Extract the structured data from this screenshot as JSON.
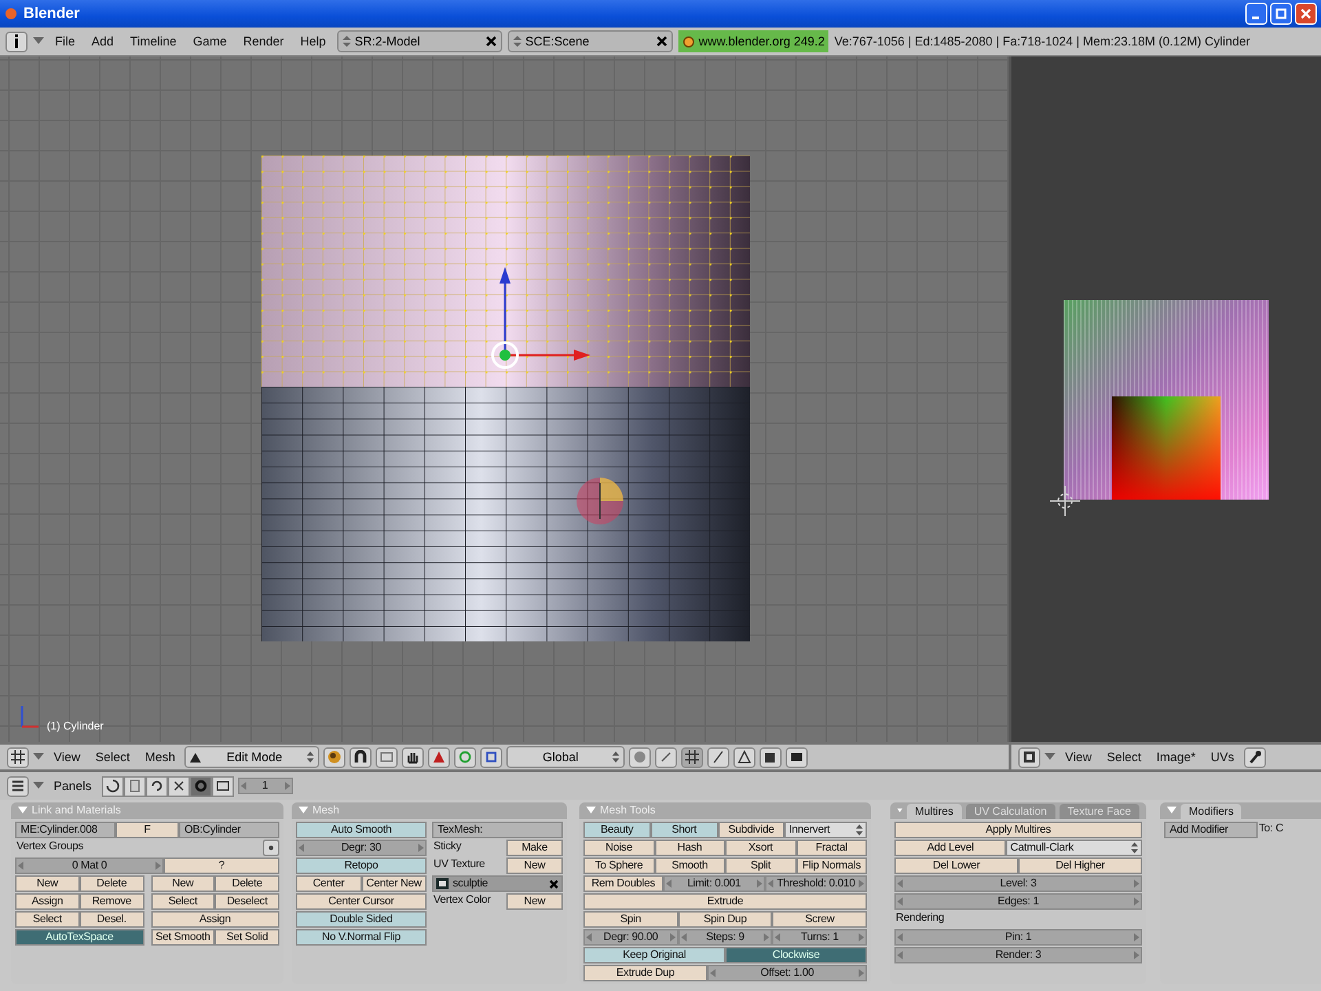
{
  "window": {
    "title": "Blender"
  },
  "menubar": {
    "menus": [
      "File",
      "Add",
      "Timeline",
      "Game",
      "Render",
      "Help"
    ],
    "screen": "SR:2-Model",
    "scene": "SCE:Scene",
    "version": "www.blender.org 249.2",
    "stats": "Ve:767-1056 | Ed:1485-2080 | Fa:718-1024 | Mem:23.18M (0.12M) Cylinder"
  },
  "viewport": {
    "object_label": "(1) Cylinder"
  },
  "viewport_header": {
    "menus": [
      "View",
      "Select",
      "Mesh"
    ],
    "mode": "Edit Mode",
    "orientation": "Global"
  },
  "uv_header": {
    "menus": [
      "View",
      "Select",
      "Image*",
      "UVs"
    ]
  },
  "buttons_header": {
    "label": "Panels",
    "number": "1"
  },
  "panels": [
    {
      "title": "Link and Materials",
      "columns": [
        {
          "rows": [
            [
              [
                {
                  "kind": "field",
                  "text": "ME:Cylinder.008"
                },
                {
                  "kind": "button",
                  "text": "F"
                },
                {
                  "kind": "field",
                  "text": "OB:Cylinder"
                }
              ]
            ],
            [
              [
                {
                  "kind": "label",
                  "text": "Vertex Groups"
                },
                {
                  "kind": "iconbutton"
                }
              ]
            ],
            [
              [
                {
                  "kind": "num",
                  "text": "0 Mat 0"
                },
                {
                  "kind": "button",
                  "text": "?"
                }
              ]
            ],
            [
              [
                {
                  "kind": "button",
                  "text": "New"
                },
                {
                  "kind": "button",
                  "text": "Delete"
                }
              ],
              [
                {
                  "kind": "button",
                  "text": "New"
                },
                {
                  "kind": "button",
                  "text": "Delete"
                }
              ]
            ],
            [
              [
                {
                  "kind": "button",
                  "text": "Assign"
                },
                {
                  "kind": "button",
                  "text": "Remove"
                }
              ],
              [
                {
                  "kind": "button",
                  "text": "Select"
                },
                {
                  "kind": "button",
                  "text": "Deselect"
                }
              ]
            ],
            [
              [
                {
                  "kind": "button",
                  "text": "Select"
                },
                {
                  "kind": "button",
                  "text": "Desel."
                }
              ],
              [
                {
                  "kind": "button",
                  "text": "Assign"
                }
              ]
            ],
            [
              [
                {
                  "kind": "toggle",
                  "text": "AutoTexSpace",
                  "on": true
                }
              ],
              [
                {
                  "kind": "button",
                  "text": "Set Smooth"
                },
                {
                  "kind": "button",
                  "text": "Set Solid"
                }
              ]
            ]
          ]
        }
      ]
    },
    {
      "title": "Mesh",
      "columns": [
        {
          "rows": [
            [
              [
                {
                  "kind": "toggle",
                  "text": "Auto Smooth",
                  "on": false
                }
              ]
            ],
            [
              [
                {
                  "kind": "num",
                  "text": "Degr: 30"
                }
              ]
            ],
            [
              [
                {
                  "kind": "toggle",
                  "text": "Retopo",
                  "on": false
                }
              ]
            ],
            [
              [
                {
                  "kind": "button",
                  "text": "Center"
                },
                {
                  "kind": "button",
                  "text": "Center New"
                }
              ]
            ],
            [
              [
                {
                  "kind": "button",
                  "text": "Center Cursor"
                }
              ]
            ],
            [
              [
                {
                  "kind": "toggle",
                  "text": "Double Sided",
                  "on": false
                }
              ]
            ],
            [
              [
                {
                  "kind": "toggle",
                  "text": "No V.Normal Flip",
                  "on": false
                }
              ]
            ]
          ]
        },
        {
          "rows": [
            [
              [
                {
                  "kind": "field",
                  "text": "TexMesh:"
                }
              ]
            ],
            [
              [
                {
                  "kind": "label",
                  "text": "Sticky"
                },
                {
                  "kind": "button",
                  "text": "Make"
                }
              ]
            ],
            [
              [
                {
                  "kind": "label",
                  "text": "UV Texture"
                },
                {
                  "kind": "button",
                  "text": "New"
                }
              ]
            ],
            [
              [
                {
                  "kind": "layer",
                  "text": "sculptie"
                }
              ]
            ],
            [
              [
                {
                  "kind": "label",
                  "text": "Vertex Color"
                },
                {
                  "kind": "button",
                  "text": "New"
                }
              ]
            ]
          ]
        }
      ]
    },
    {
      "title": "Mesh Tools",
      "columns": [
        {
          "rows": [
            [
              [
                {
                  "kind": "toggle",
                  "text": "Beauty",
                  "on": false
                },
                {
                  "kind": "toggle",
                  "text": "Short",
                  "on": false
                },
                {
                  "kind": "button",
                  "text": "Subdivide"
                },
                {
                  "kind": "menu",
                  "text": "Innervert"
                }
              ]
            ],
            [
              [
                {
                  "kind": "button",
                  "text": "Noise"
                },
                {
                  "kind": "button",
                  "text": "Hash"
                },
                {
                  "kind": "button",
                  "text": "Xsort"
                },
                {
                  "kind": "button",
                  "text": "Fractal"
                }
              ]
            ],
            [
              [
                {
                  "kind": "button",
                  "text": "To Sphere"
                },
                {
                  "kind": "button",
                  "text": "Smooth"
                },
                {
                  "kind": "button",
                  "text": "Split"
                },
                {
                  "kind": "button",
                  "text": "Flip Normals"
                }
              ]
            ],
            [
              [
                {
                  "kind": "button",
                  "text": "Rem Doubles"
                },
                {
                  "kind": "num",
                  "text": "Limit: 0.001"
                },
                {
                  "kind": "num",
                  "text": "Threshold: 0.010"
                }
              ]
            ],
            [
              [
                {
                  "kind": "button",
                  "text": "Extrude"
                }
              ]
            ],
            [
              [
                {
                  "kind": "button",
                  "text": "Spin"
                },
                {
                  "kind": "button",
                  "text": "Spin Dup"
                },
                {
                  "kind": "button",
                  "text": "Screw"
                }
              ]
            ],
            [
              [
                {
                  "kind": "num",
                  "text": "Degr: 90.00"
                },
                {
                  "kind": "num",
                  "text": "Steps: 9"
                },
                {
                  "kind": "num",
                  "text": "Turns: 1"
                }
              ]
            ],
            [
              [
                {
                  "kind": "toggle",
                  "text": "Keep Original",
                  "on": false
                },
                {
                  "kind": "toggle",
                  "text": "Clockwise",
                  "on": true
                }
              ]
            ],
            [
              [
                {
                  "kind": "button",
                  "text": "Extrude Dup"
                },
                {
                  "kind": "num",
                  "text": "Offset: 1.00"
                }
              ]
            ]
          ]
        }
      ]
    },
    {
      "tabs": [
        {
          "label": "Multires",
          "selected": true
        },
        {
          "label": "UV Calculation",
          "selected": false
        },
        {
          "label": "Texture Face",
          "selected": false
        }
      ],
      "columns": [
        {
          "rows": [
            [
              [
                {
                  "kind": "button",
                  "text": "Apply Multires"
                }
              ]
            ],
            [
              [
                {
                  "kind": "button",
                  "text": "Add Level"
                },
                {
                  "kind": "menu",
                  "text": "Catmull-Clark"
                }
              ]
            ],
            [
              [
                {
                  "kind": "button",
                  "text": "Del Lower"
                },
                {
                  "kind": "button",
                  "text": "Del Higher"
                }
              ]
            ],
            [
              [
                {
                  "kind": "num",
                  "text": "Level: 3"
                }
              ]
            ],
            [
              [
                {
                  "kind": "num",
                  "text": "Edges: 1"
                }
              ]
            ],
            [
              [
                {
                  "kind": "label",
                  "text": "Rendering"
                }
              ]
            ],
            [
              [
                {
                  "kind": "num",
                  "text": "Pin: 1"
                }
              ]
            ],
            [
              [
                {
                  "kind": "num",
                  "text": "Render: 3"
                }
              ]
            ]
          ]
        }
      ]
    },
    {
      "tabs": [
        {
          "label": "Modifiers",
          "selected": true
        }
      ],
      "columns": [
        {
          "rows": [
            [
              [
                {
                  "kind": "field",
                  "text": "Add Modifier"
                },
                {
                  "kind": "label",
                  "text": "To: C"
                }
              ]
            ]
          ]
        }
      ]
    }
  ]
}
